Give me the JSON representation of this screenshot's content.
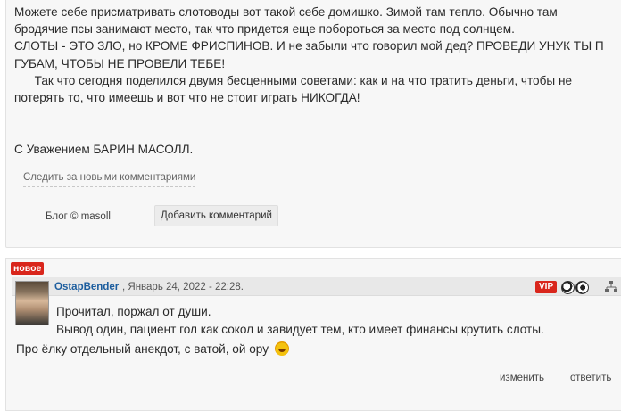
{
  "post": {
    "lines": [
      "Можете себе присматривать слотоводы вот такой себе домишко. Зимой там тепло. Обычно там",
      "бродячие псы занимают место, так что придется еще побороться за место под солнцем.",
      "СЛОТЫ - ЭТО ЗЛО, но КРОМЕ ФРИСПИНОВ. И не забыли что говорил мой дед? ПРОВЕДИ УНУК ТЫ П",
      "ГУБАМ, ЧТОБЫ НЕ ПРОВЕЛИ ТЕБЕ!",
      "      Так что сегодня поделился двумя бесценными советами: как и на что тратить деньги, чтобы не",
      "потерять то, что имеешь и вот что не стоит играть НИКОГДА!"
    ],
    "signature": "С Уважением БАРИН МАСОЛЛ.",
    "follow_label": "Следить за новыми комментариями",
    "blog_label": "Блог © masoll",
    "add_comment_label": "Добавить комментарий"
  },
  "comment": {
    "badge": "новое",
    "author": "OstapBender",
    "date": ", Январь 24, 2022 - 22:28.",
    "vip_label": "VIP",
    "lines": [
      "Прочитал, поржал от души.",
      "Вывод один, пациент гол как сокол и завидует тем, кто имеет финансы крутить слоты."
    ],
    "extra_line": "Про ёлку отдельный анекдот, с ватой, ой ору ",
    "edit_label": "изменить",
    "reply_label": "ответить"
  },
  "colors": {
    "badge_red": "#d9261c",
    "author_blue": "#1c5d9e"
  }
}
